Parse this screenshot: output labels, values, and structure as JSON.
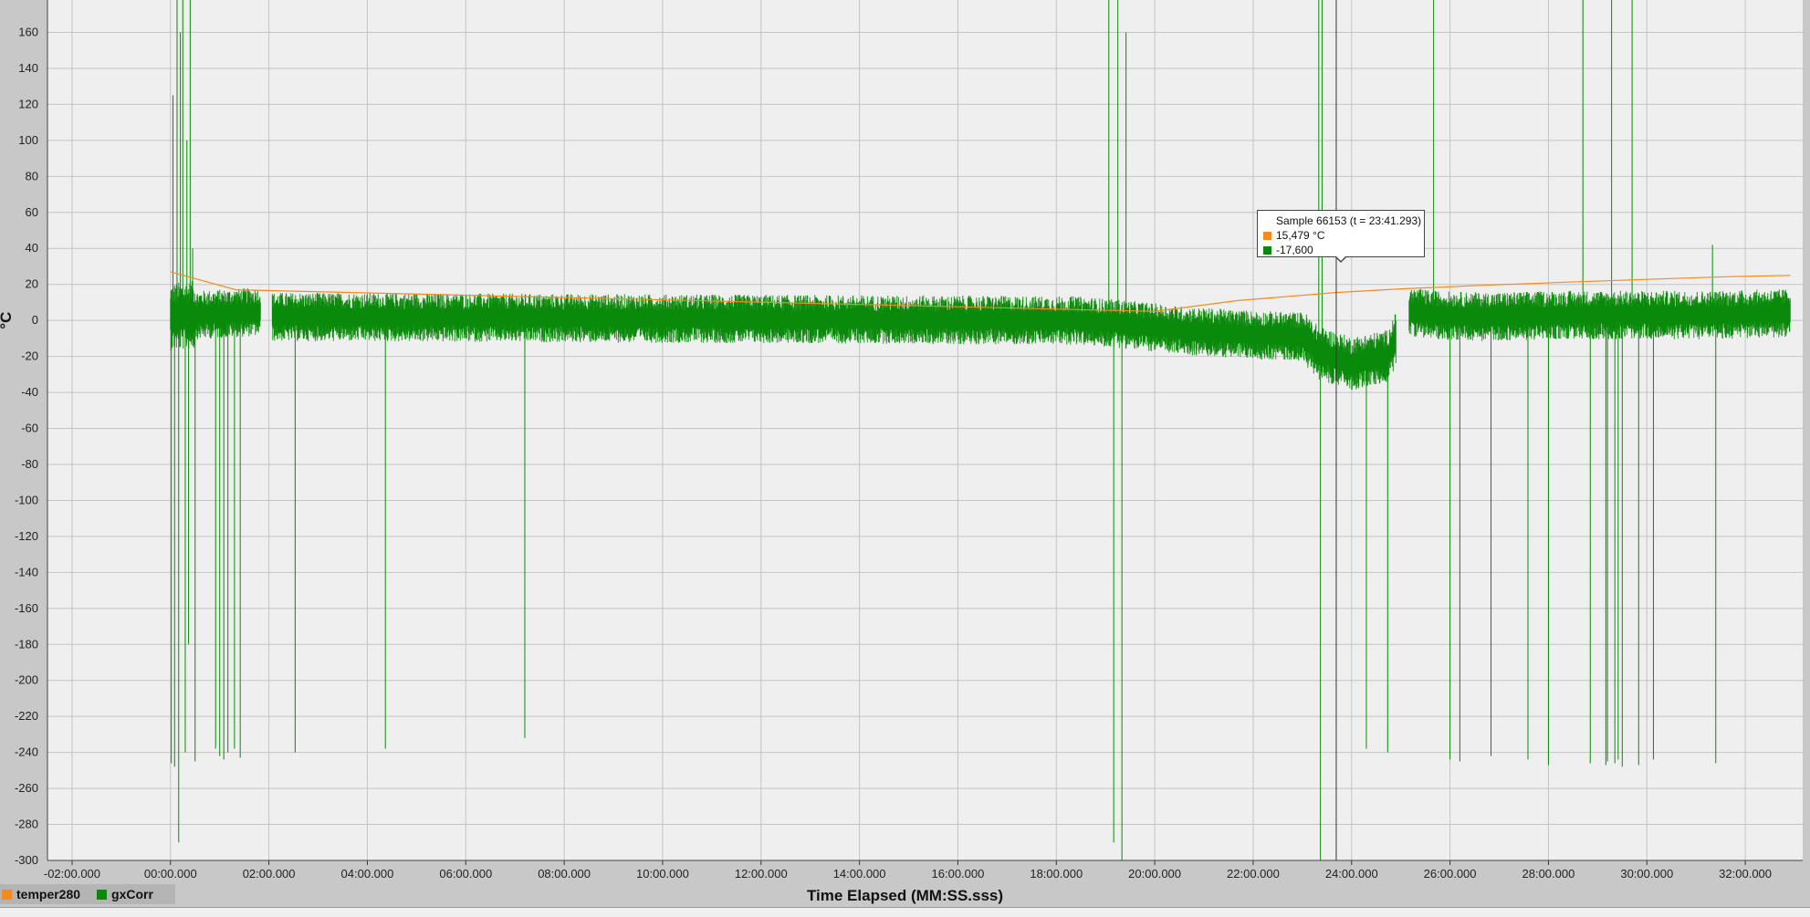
{
  "chart_data": {
    "type": "line",
    "title": "",
    "xlabel": "Time Elapsed (MM:SS.sss)",
    "ylabel": "°C",
    "xlim": [
      -150,
      1990
    ],
    "ylim": [
      -300,
      178
    ],
    "x_tick_values": [
      -120,
      0,
      120,
      240,
      360,
      480,
      600,
      720,
      840,
      960,
      1080,
      1200,
      1320,
      1440,
      1560,
      1680,
      1800,
      1920
    ],
    "x_tick_labels": [
      "-02:00.000",
      "00:00.000",
      "02:00.000",
      "04:00.000",
      "06:00.000",
      "08:00.000",
      "10:00.000",
      "12:00.000",
      "14:00.000",
      "16:00.000",
      "18:00.000",
      "20:00.000",
      "22:00.000",
      "24:00.000",
      "26:00.000",
      "28:00.000",
      "30:00.000",
      "32:00.000"
    ],
    "y_ticks": [
      160,
      140,
      120,
      100,
      80,
      60,
      40,
      20,
      0,
      -20,
      -40,
      -60,
      -80,
      -100,
      -120,
      -140,
      -160,
      -180,
      -200,
      -220,
      -240,
      -260,
      -280,
      -300
    ],
    "grid": true,
    "legend_position": "bottom-left",
    "series": [
      {
        "name": "temper280",
        "color": "#f58a1f",
        "x": [
          0,
          40,
          80,
          1200,
          1300,
          1421,
          1500,
          1600,
          1700,
          1800,
          1900,
          1975
        ],
        "y": [
          27,
          22,
          17,
          5,
          11,
          15.5,
          17.5,
          19.5,
          21.2,
          22.8,
          24.3,
          25
        ]
      },
      {
        "name": "gxCorr",
        "color": "#0a8a0a",
        "baseline_x": [
          0,
          30,
          118,
          124,
          1100,
          1160,
          1240,
          1320,
          1380,
          1400,
          1440,
          1484,
          1510,
          1540,
          1600,
          1700,
          1800,
          1880,
          1975
        ],
        "baseline_y": [
          2,
          3,
          5,
          2,
          0,
          -2,
          -6,
          -8,
          -9,
          -18,
          -24,
          -20,
          5,
          3,
          2,
          3,
          3,
          3,
          4
        ],
        "spikes_x": [
          1,
          3,
          5,
          8,
          10,
          12,
          15,
          18,
          20,
          22,
          24,
          27,
          30,
          55,
          60,
          65,
          70,
          78,
          85,
          152,
          262,
          432,
          1144,
          1150,
          1155,
          1160,
          1165,
          1400,
          1402,
          1404,
          1458,
          1484,
          1540,
          1560,
          1572,
          1610,
          1655,
          1680,
          1722,
          1731,
          1750,
          1752,
          1757,
          1761,
          1765,
          1770,
          1782,
          1790,
          1808,
          1880,
          1884
        ],
        "spikes_y": [
          -246,
          125,
          -248,
          178,
          -290,
          160,
          178,
          -240,
          100,
          -180,
          178,
          40,
          -245,
          -238,
          -242,
          -244,
          -240,
          -238,
          -243,
          -240,
          -238,
          -232,
          178,
          -290,
          178,
          -300,
          160,
          178,
          -300,
          178,
          -238,
          -240,
          178,
          -244,
          -245,
          -242,
          -244,
          -247,
          178,
          -246,
          -247,
          -245,
          178,
          -246,
          -244,
          -248,
          178,
          -247,
          -244,
          42,
          -246
        ]
      }
    ],
    "tooltip": {
      "title": "Sample 66153 (t = 23:41.293)",
      "temper280_value": "15,479 °C",
      "gxCorr_value": "-17,600",
      "cursor_x": 1421.293
    }
  },
  "legend": {
    "temper280_label": "temper280",
    "gxCorr_label": "gxCorr"
  },
  "colors": {
    "plot_background": "#efefef",
    "page_background": "#c8c8c8",
    "grid": "#c4c4c4"
  }
}
